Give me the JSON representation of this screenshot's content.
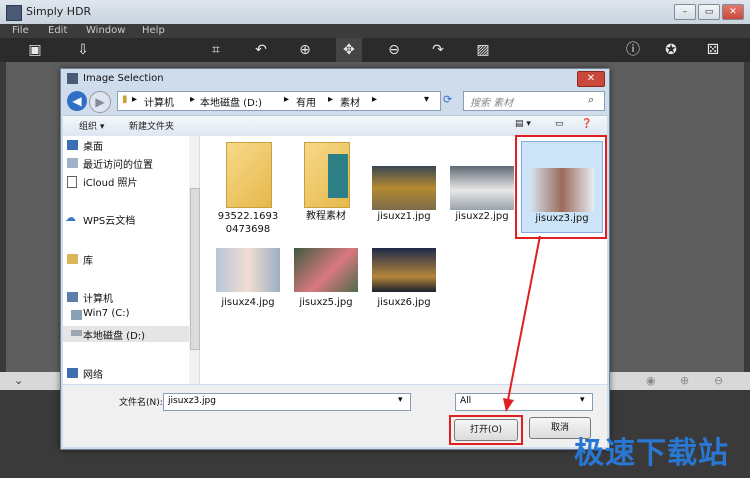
{
  "app": {
    "title": "Simply HDR",
    "menu": [
      "File",
      "Edit",
      "Window",
      "Help"
    ],
    "window_buttons": [
      "–",
      "▭",
      "✕"
    ]
  },
  "dialog": {
    "title": "Image Selection",
    "breadcrumb": [
      "计算机",
      "本地磁盘 (D:)",
      "有用",
      "素材"
    ],
    "search_placeholder": "搜索 素材",
    "commands": {
      "organize": "组织 ▾",
      "new_folder": "新建文件夹"
    },
    "nav_items": [
      {
        "label": "桌面",
        "icon": "desktop-icon"
      },
      {
        "label": "最近访问的位置",
        "icon": "recent-icon"
      },
      {
        "label": "iCloud 照片",
        "icon": "icloud-icon"
      },
      {
        "label": "WPS云文档",
        "icon": "cloud-icon"
      },
      {
        "label": "库",
        "icon": "library-icon"
      },
      {
        "label": "计算机",
        "icon": "computer-icon"
      },
      {
        "label": "Win7 (C:)",
        "icon": "drive-icon"
      },
      {
        "label": "本地磁盘 (D:)",
        "icon": "drive-icon"
      },
      {
        "label": "网络",
        "icon": "network-icon"
      }
    ],
    "files": [
      {
        "label": "93522.16930473698",
        "label_line1": "93522.1693",
        "label_line2": "0473698",
        "kind": "folder"
      },
      {
        "label": "教程素材",
        "kind": "folder"
      },
      {
        "label": "jisuxz1.jpg",
        "kind": "image"
      },
      {
        "label": "jisuxz2.jpg",
        "kind": "image"
      },
      {
        "label": "jisuxz3.jpg",
        "kind": "image",
        "selected": true
      },
      {
        "label": "jisuxz4.jpg",
        "kind": "image"
      },
      {
        "label": "jisuxz5.jpg",
        "kind": "image"
      },
      {
        "label": "jisuxz6.jpg",
        "kind": "image"
      }
    ],
    "filename_label": "文件名(N):",
    "filename_value": "jisuxz3.jpg",
    "filetype_value": "All",
    "open_button": "打开(O)",
    "cancel_button": "取消"
  },
  "watermark": "极速下载站",
  "colors": {
    "highlight": "#e02020",
    "accent": "#2a77d3",
    "selected_bg": "#cce4f7"
  }
}
